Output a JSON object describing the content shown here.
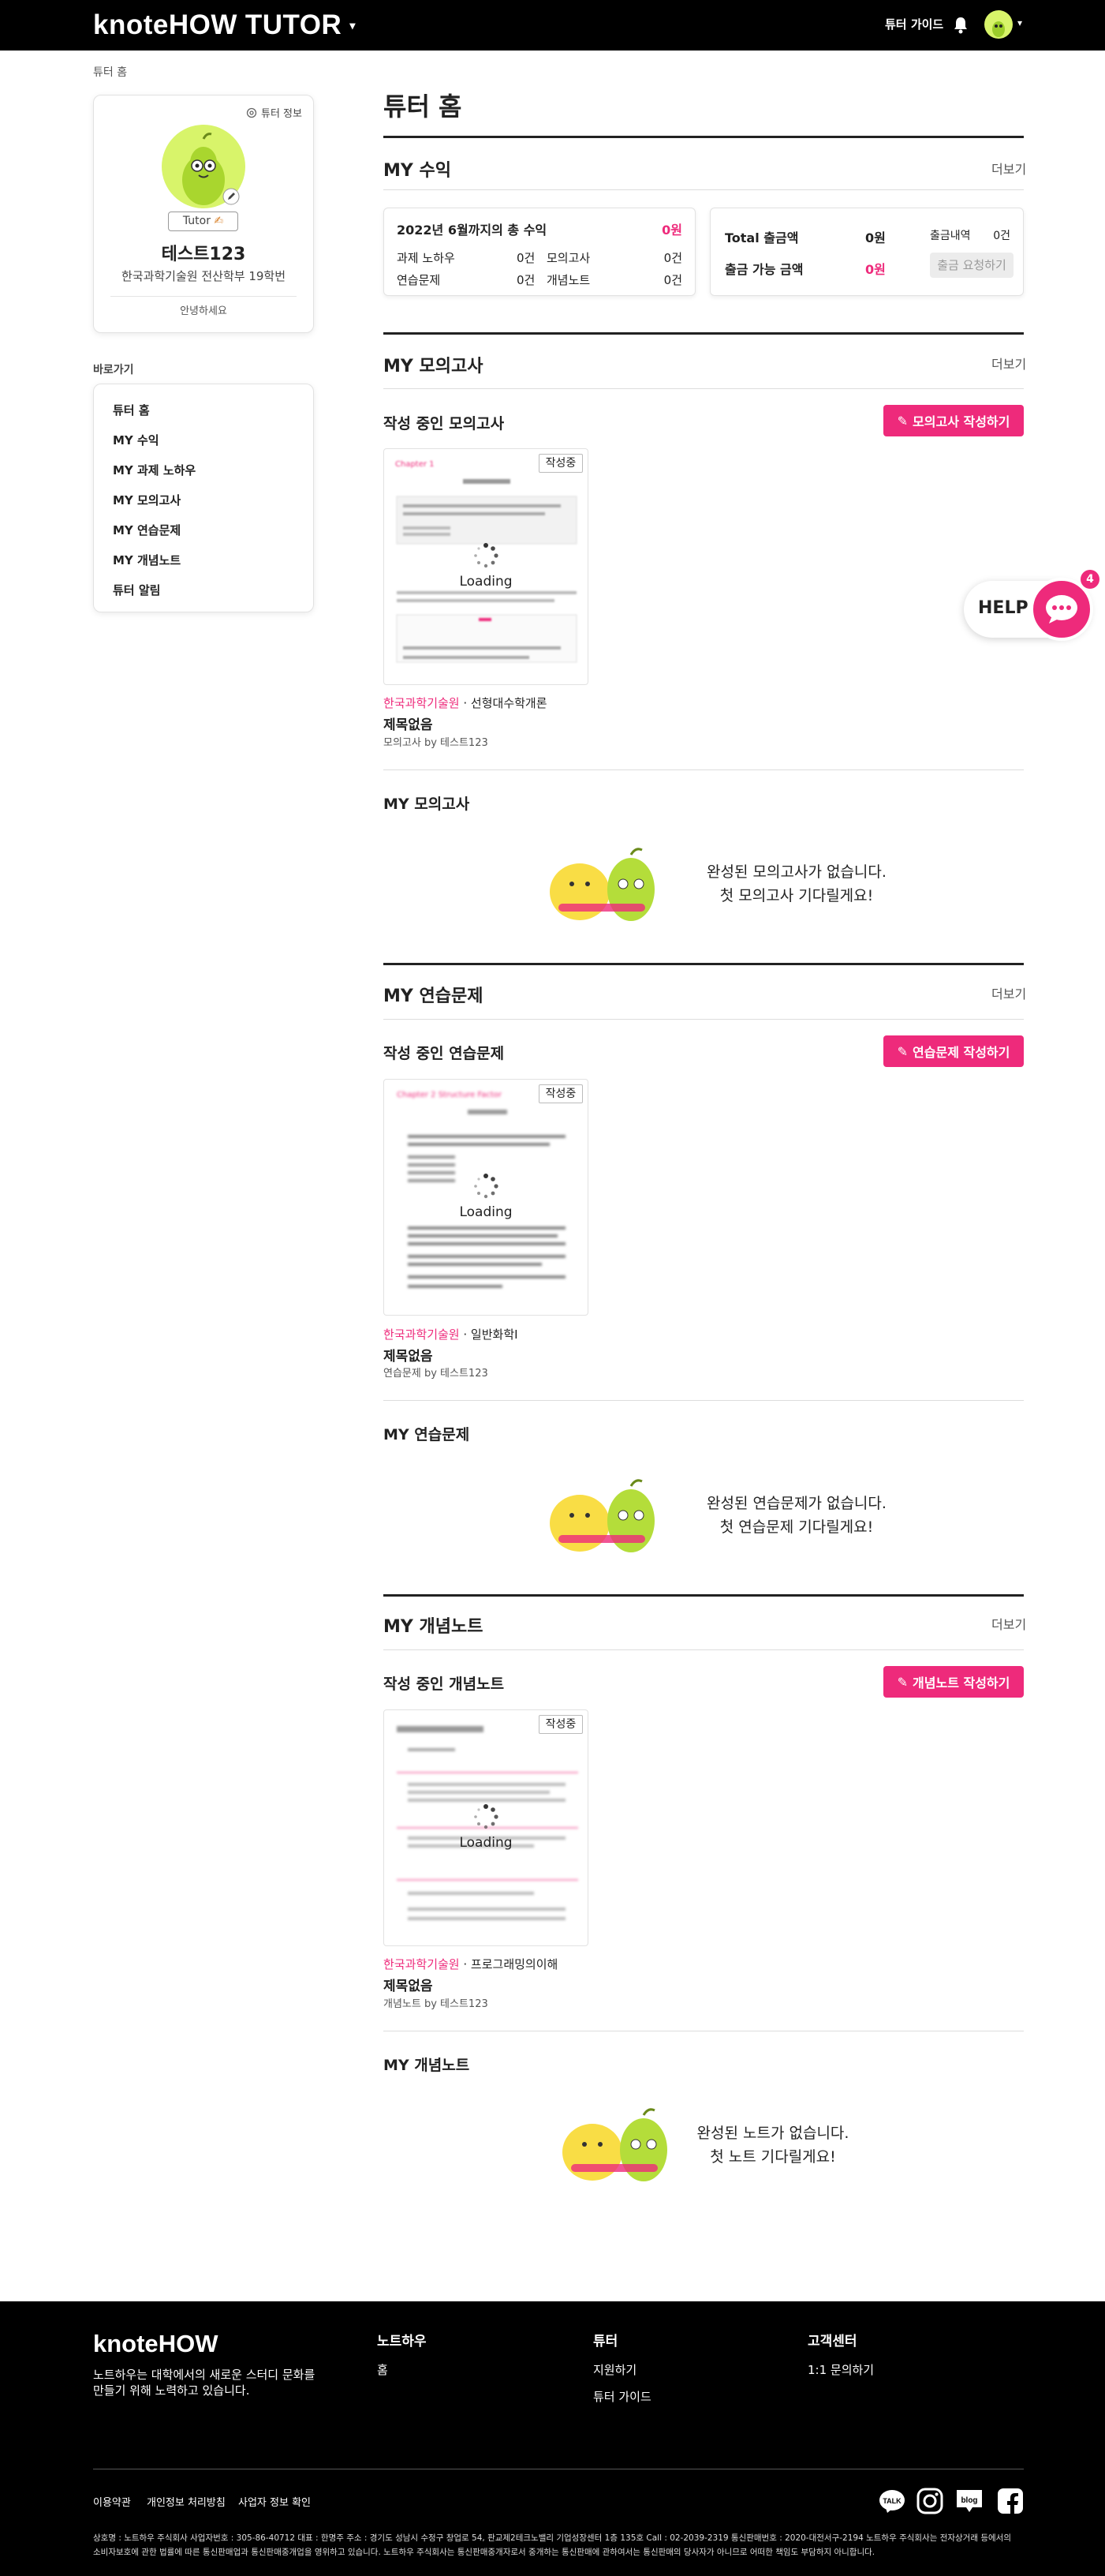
{
  "header": {
    "logo_prefix": "knote",
    "logo_how": "HOW",
    "logo_tutor": "TUTOR",
    "logo_chevron": "chevron-down-icon",
    "tutor_guide": "튜터 가이드",
    "bell_icon": "bell-icon"
  },
  "breadcrumb": "튜터 홈",
  "profile": {
    "tutor_info": "튜터 정보",
    "badge": "Tutor",
    "name": "테스트123",
    "university": "한국과학기술원 전산학부 19학번",
    "greeting": "안녕하세요"
  },
  "shortcuts": {
    "title": "바로가기",
    "items": [
      "튜터 홈",
      "MY 수익",
      "MY 과제 노하우",
      "MY 모의고사",
      "MY 연습문제",
      "MY 개념노트",
      "튜터 알림"
    ]
  },
  "page_title": "튜터 홈",
  "more": "더보기",
  "revenue": {
    "title": "MY 수익",
    "total_label": "2022년 6월까지의 총 수익",
    "total_value": "0원",
    "rows": [
      {
        "label": "과제 노하우",
        "value": "0건"
      },
      {
        "label": "모의고사",
        "value": "0건"
      },
      {
        "label": "연습문제",
        "value": "0건"
      },
      {
        "label": "개념노트",
        "value": "0건"
      }
    ],
    "withdraw_total_label": "Total 출금액",
    "withdraw_total_value": "0원",
    "withdraw_history_label": "출금내역",
    "withdraw_history_value": "0건",
    "available_label": "출금 가능 금액",
    "available_value": "0원",
    "withdraw_button": "출금 요청하기"
  },
  "mock": {
    "title": "MY 모의고사",
    "wip_title": "작성 중인 모의고사",
    "create_button": "모의고사 작성하기",
    "wip_badge": "작성중",
    "loading": "Loading",
    "school": "한국과학기술원",
    "sep": " · ",
    "course": "선형대수학개론",
    "item_title": "제목없음",
    "by": "모의고사 by 테스트123",
    "done_title": "MY 모의고사",
    "empty_line1": "완성된 모의고사가 없습니다.",
    "empty_line2": "첫 모의고사 기다릴게요!"
  },
  "practice": {
    "title": "MY 연습문제",
    "wip_title": "작성 중인 연습문제",
    "create_button": "연습문제 작성하기",
    "wip_badge": "작성중",
    "loading": "Loading",
    "school": "한국과학기술원",
    "sep": " · ",
    "course": "일반화학I",
    "item_title": "제목없음",
    "by": "연습문제 by 테스트123",
    "done_title": "MY 연습문제",
    "empty_line1": "완성된 연습문제가 없습니다.",
    "empty_line2": "첫 연습문제 기다릴게요!"
  },
  "notes": {
    "title": "MY 개념노트",
    "wip_title": "작성 중인 개념노트",
    "create_button": "개념노트 작성하기",
    "wip_badge": "작성중",
    "loading": "Loading",
    "school": "한국과학기술원",
    "sep": " · ",
    "course": "프로그래밍의이해",
    "item_title": "제목없음",
    "by": "개념노트 by 테스트123",
    "done_title": "MY 개념노트",
    "empty_line1": "완성된 노트가 없습니다.",
    "empty_line2": "첫 노트 기다릴게요!"
  },
  "help": {
    "label": "HELP",
    "count": "4"
  },
  "footer": {
    "logo_prefix": "knote",
    "logo_how": "HOW",
    "desc_line1": "노트하우는 대학에서의 새로운 스터디 문화를",
    "desc_line2": "만들기 위해 노력하고 있습니다.",
    "col1_title": "노트하우",
    "col1_items": [
      "홈"
    ],
    "col2_title": "튜터",
    "col2_items": [
      "지원하기",
      "튜터 가이드"
    ],
    "col3_title": "고객센터",
    "col3_items": [
      "1:1 문의하기"
    ],
    "links": [
      "이용약관",
      "개인정보 처리방침",
      "사업자 정보 확인"
    ],
    "social": [
      "TALK",
      "instagram-icon",
      "blog",
      "facebook-icon"
    ],
    "legal_line1": "상호명 : 노트하우 주식회사 사업자번호 : 305-86-40712 대표 : 한명주 주소 : 경기도 성남시 수정구 창업로 54, 판교제2테크노밸리 기업성장센터 1층 135호 Call : 02-2039-2319 통신판매번호 : 2020-대전서구-2194 노트하우 주식회사는 전자상거래 등에서의",
    "legal_line2": "소비자보호에 관한 법률에 따른 통신판매업과 통신판매중개업을 영위하고 있습니다. 노트하우 주식회사는 통신판매중개자로서 중개하는 통신판매에 관하여서는 통신판매의 당사자가 아니므로 어떠한 책임도 부담하지 아니합니다."
  },
  "colors": {
    "accent": "#ee2a7b",
    "header_bg": "#000000",
    "avatar": "#d8f46a"
  }
}
